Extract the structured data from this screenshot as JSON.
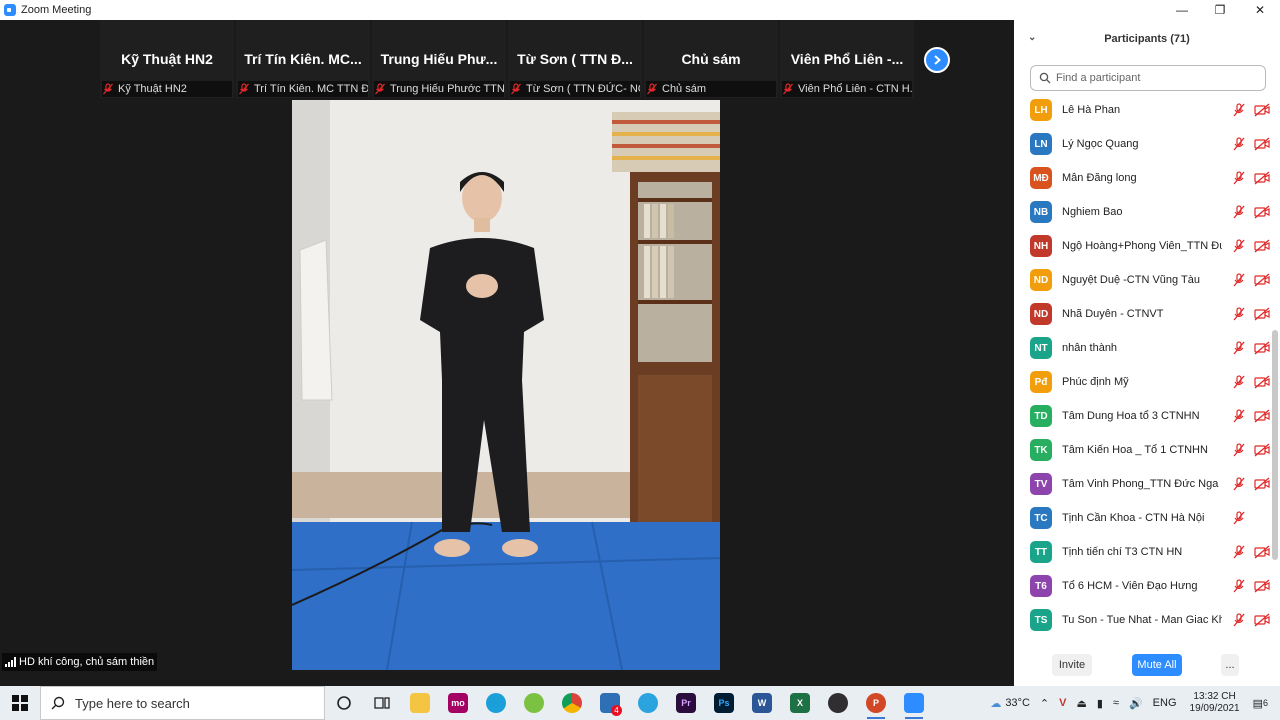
{
  "window": {
    "title": "Zoom Meeting"
  },
  "thumbnails": [
    {
      "big": "Kỹ Thuật HN2",
      "small": "Kỹ Thuật HN2"
    },
    {
      "big": "Trí Tín Kiên. MC...",
      "small": "Trí Tín Kiên. MC  TTN Đ..."
    },
    {
      "big": "Trung Hiếu Phư...",
      "small": "Trung Hiếu Phước TTN..."
    },
    {
      "big": "Từ Sơn ( TTN Đ...",
      "small": "Từ Sơn ( TTN ĐỨC- NG..."
    },
    {
      "big": "Chủ sám",
      "small": "Chủ sám"
    },
    {
      "big": "Viên Phổ Liên -...",
      "small": "Viên Phổ Liên - CTN H..."
    }
  ],
  "main_video": {
    "label": "HD khí công, chủ sám thiền"
  },
  "participants": {
    "header": "Participants (71)",
    "search_placeholder": "Find a participant",
    "list": [
      {
        "initials": "LH",
        "name": "Lê Hà Phan",
        "color": "#f29e0c",
        "video_icon": true
      },
      {
        "initials": "LN",
        "name": "Lý Ngọc Quang",
        "color": "#2a78c0",
        "video_icon": true
      },
      {
        "initials": "MĐ",
        "name": "Mẫn Đăng long",
        "color": "#d9531e",
        "video_icon": true
      },
      {
        "initials": "NB",
        "name": "Nghiem Bao",
        "color": "#2a78c0",
        "video_icon": true
      },
      {
        "initials": "NH",
        "name": "Ngộ Hoàng+Phong Viên_TTN Đứ...",
        "color": "#c0392b",
        "video_icon": true
      },
      {
        "initials": "ND",
        "name": "Nguyệt Duệ -CTN Vũng Tàu",
        "color": "#f29e0c",
        "video_icon": true
      },
      {
        "initials": "ND",
        "name": "Nhã Duyên - CTNVT",
        "color": "#c0392b",
        "video_icon": true
      },
      {
        "initials": "NT",
        "name": "nhẫn thành",
        "color": "#1aa58a",
        "video_icon": true
      },
      {
        "initials": "Pđ",
        "name": "Phúc định Mỹ",
        "color": "#f29e0c",
        "video_icon": true
      },
      {
        "initials": "TD",
        "name": "Tâm Dung Hoa tổ 3 CTNHN",
        "color": "#27ae60",
        "video_icon": true
      },
      {
        "initials": "TK",
        "name": "Tâm Kiến Hoa _ Tổ 1 CTNHN",
        "color": "#27ae60",
        "video_icon": true
      },
      {
        "initials": "TV",
        "name": "Tâm Vinh Phong_TTN Đức Nga",
        "color": "#8e44ad",
        "video_icon": true
      },
      {
        "initials": "TC",
        "name": "Tịnh Cần Khoa - CTN Hà Nội",
        "color": "#2a78c0",
        "video_icon": false
      },
      {
        "initials": "TT",
        "name": "Tịnh tiến chí T3 CTN HN",
        "color": "#1aa58a",
        "video_icon": true
      },
      {
        "initials": "T6",
        "name": "Tổ 6 HCM - Viên Đạo Hưng",
        "color": "#8e44ad",
        "video_icon": true
      },
      {
        "initials": "TS",
        "name": "Tu Son - Tue Nhat - Man Giac Khai",
        "color": "#1aa58a",
        "video_icon": true
      }
    ],
    "invite_label": "Invite",
    "mute_all_label": "Mute All",
    "more_label": "..."
  },
  "taskbar": {
    "search_text": "Type here to search",
    "mail_badge": "4",
    "weather": "33°C",
    "language": "ENG",
    "time": "13:32 CH",
    "date": "19/09/2021",
    "notif_count": "6"
  },
  "colors": {
    "accent": "#2d8cff",
    "muted_red": "#e02828"
  }
}
